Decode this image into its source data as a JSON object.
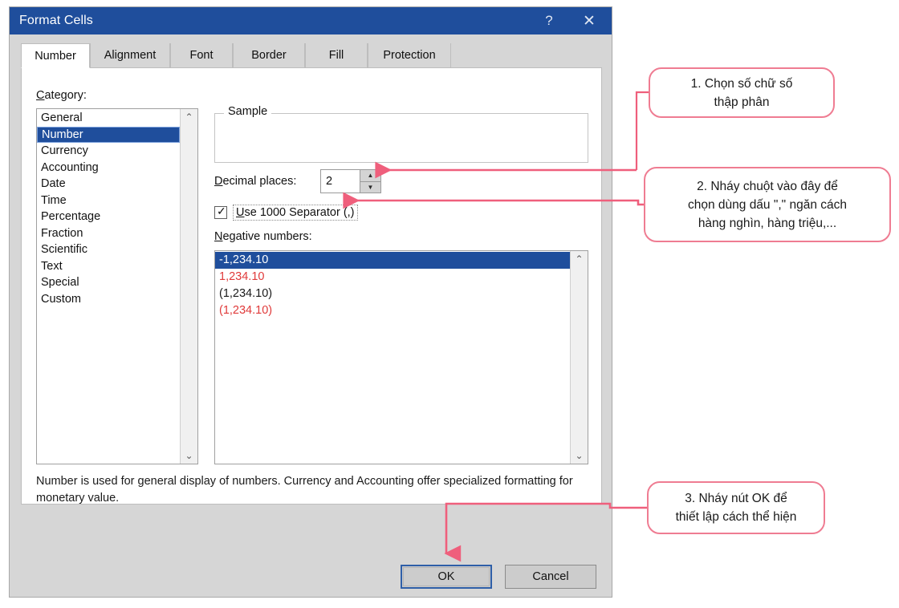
{
  "dialog": {
    "title": "Format Cells",
    "help_icon": "?",
    "close_icon": "✕",
    "tabs": [
      {
        "label": "Number",
        "active": true
      },
      {
        "label": "Alignment",
        "active": false
      },
      {
        "label": "Font",
        "active": false
      },
      {
        "label": "Border",
        "active": false
      },
      {
        "label": "Fill",
        "active": false
      },
      {
        "label": "Protection",
        "active": false
      }
    ],
    "category": {
      "label": "Category:",
      "items": [
        "General",
        "Number",
        "Currency",
        "Accounting",
        "Date",
        "Time",
        "Percentage",
        "Fraction",
        "Scientific",
        "Text",
        "Special",
        "Custom"
      ],
      "selected": "Number",
      "scroll_up_icon": "⌃",
      "scroll_down_icon": "⌄"
    },
    "sample": {
      "legend": "Sample",
      "value": ""
    },
    "decimal_places": {
      "label": "Decimal places:",
      "value": "2",
      "spin_up_icon": "▲",
      "spin_down_icon": "▼"
    },
    "use_1000_separator": {
      "label": "Use 1000 Separator (,)",
      "checked": true,
      "check_icon": "✓"
    },
    "negative_numbers": {
      "label": "Negative numbers:",
      "items": [
        {
          "text": "-1,234.10",
          "style": "selected"
        },
        {
          "text": "1,234.10",
          "style": "red"
        },
        {
          "text": "(1,234.10)",
          "style": "normal"
        },
        {
          "text": "(1,234.10)",
          "style": "red"
        }
      ],
      "scroll_up_icon": "⌃",
      "scroll_down_icon": "⌄"
    },
    "description": "Number is used for general display of numbers.  Currency and Accounting offer specialized formatting for monetary value.",
    "buttons": {
      "ok": "OK",
      "cancel": "Cancel"
    }
  },
  "annotations": [
    {
      "id": 1,
      "line1": "1. Chọn số chữ số",
      "line2": "thập phân",
      "line3": ""
    },
    {
      "id": 2,
      "line1": "2. Nháy chuột vào đây để",
      "line2": "chọn dùng dấu \",\" ngăn cách",
      "line3": "hàng nghìn, hàng triệu,..."
    },
    {
      "id": 3,
      "line1": "3. Nháy nút OK để",
      "line2": "thiết lập cách thể hiện",
      "line3": ""
    }
  ],
  "colors": {
    "titlebar": "#1f4e9c",
    "selection": "#1f4e9c",
    "callout_border": "#ef7c92",
    "arrow": "#ef5f7c",
    "negative_red": "#e03a3a",
    "dialog_face": "#d6d6d6"
  }
}
